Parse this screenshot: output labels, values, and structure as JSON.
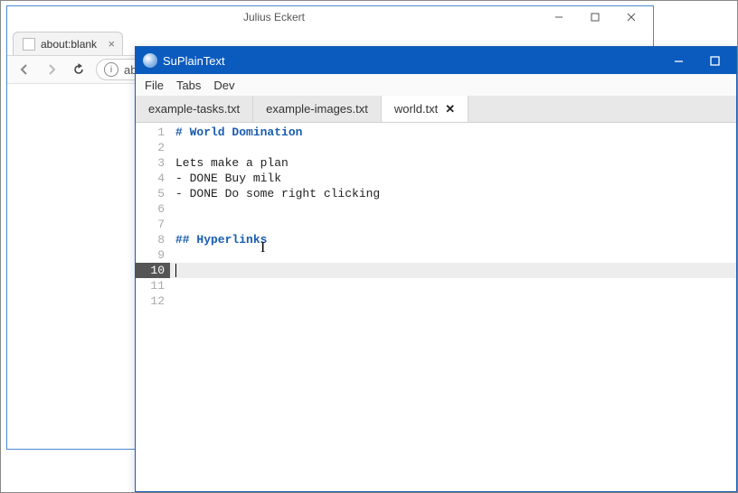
{
  "bg": {
    "window_title": "Julius Eckert",
    "tab_label": "about:blank",
    "address": "ab"
  },
  "editor": {
    "app_name": "SuPlainText",
    "menus": [
      "File",
      "Tabs",
      "Dev"
    ],
    "tabs": [
      {
        "label": "example-tasks.txt",
        "active": false,
        "closable": false
      },
      {
        "label": "example-images.txt",
        "active": false,
        "closable": false
      },
      {
        "label": "world.txt",
        "active": true,
        "closable": true
      }
    ],
    "current_line": 10,
    "lines": [
      {
        "n": 1,
        "text": "# World Domination",
        "hl": true
      },
      {
        "n": 2,
        "text": "",
        "hl": false
      },
      {
        "n": 3,
        "text": "Lets make a plan",
        "hl": false
      },
      {
        "n": 4,
        "text": "- DONE Buy milk",
        "hl": false
      },
      {
        "n": 5,
        "text": "- DONE Do some right clicking",
        "hl": false
      },
      {
        "n": 6,
        "text": "",
        "hl": false
      },
      {
        "n": 7,
        "text": "",
        "hl": false
      },
      {
        "n": 8,
        "text": "## Hyperlinks",
        "hl": true
      },
      {
        "n": 9,
        "text": "",
        "hl": false
      },
      {
        "n": 10,
        "text": "",
        "hl": false
      },
      {
        "n": 11,
        "text": "",
        "hl": false
      },
      {
        "n": 12,
        "text": "",
        "hl": false
      }
    ]
  }
}
